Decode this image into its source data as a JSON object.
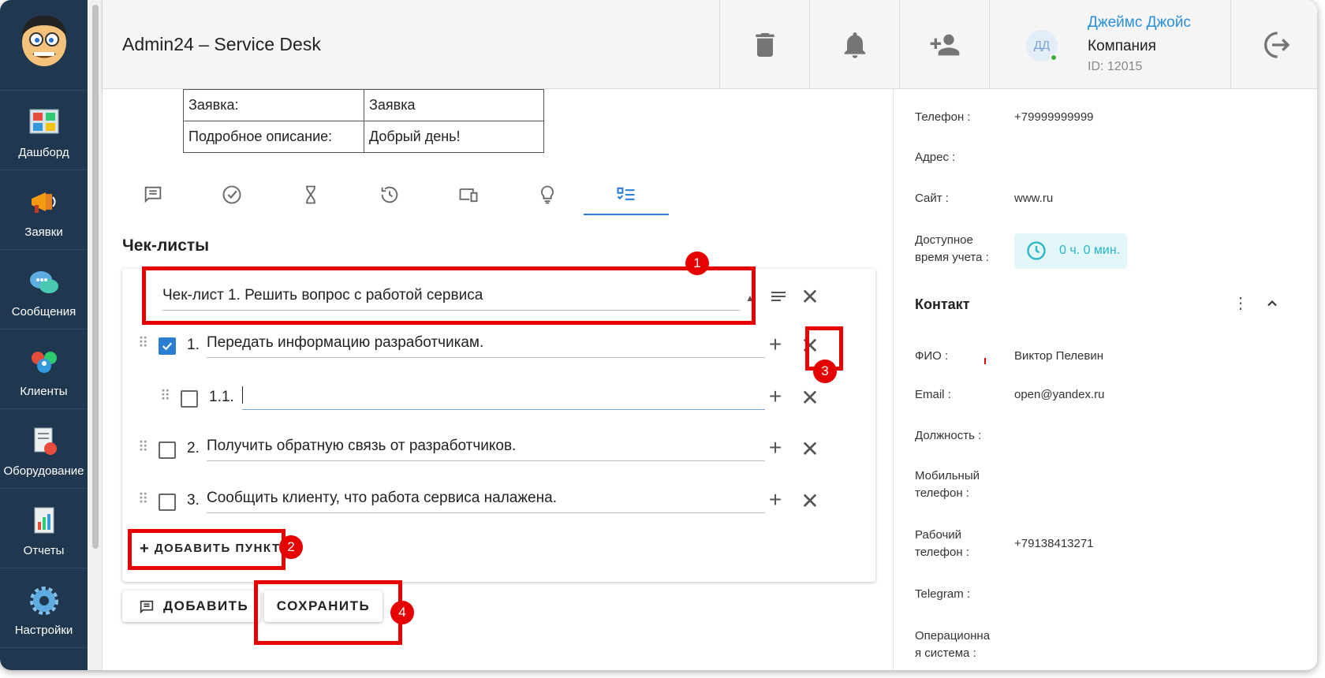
{
  "app": {
    "title": "Admin24 – Service Desk"
  },
  "sidebar": {
    "items": [
      {
        "label": "Дашборд",
        "icon": "dashboard-icon"
      },
      {
        "label": "Заявки",
        "icon": "megaphone-icon"
      },
      {
        "label": "Сообщения",
        "icon": "chat-icon"
      },
      {
        "label": "Клиенты",
        "icon": "clients-icon"
      },
      {
        "label": "Оборудование",
        "icon": "equipment-icon"
      },
      {
        "label": "Отчеты",
        "icon": "reports-icon"
      },
      {
        "label": "Настройки",
        "icon": "settings-icon"
      }
    ]
  },
  "header": {
    "user": {
      "initials": "ДД",
      "name": "Джеймс Джойс",
      "company": "Компания",
      "id": "ID: 12015"
    }
  },
  "ticket": {
    "rows": [
      {
        "key": "Заявка:",
        "value": "Заявка"
      },
      {
        "key": "Подробное описание:",
        "value": "Добрый день!"
      }
    ]
  },
  "checklists": {
    "section_title": "Чек-листы",
    "list_title": "Чек-лист 1. Решить вопрос с работой сервиса",
    "items": [
      {
        "num": "1.",
        "text": "Передать информацию разработчикам.",
        "checked": true
      },
      {
        "num": "1.1.",
        "text": "",
        "checked": false
      },
      {
        "num": "2.",
        "text": "Получить обратную связь от разработчиков.",
        "checked": false
      },
      {
        "num": "3.",
        "text": "Сообщить клиенту, что работа сервиса налажена.",
        "checked": false
      }
    ],
    "add_item_label": "ДОБАВИТЬ ПУНКТ",
    "add_label": "ДОБАВИТЬ",
    "save_label": "СОХРАНИТЬ"
  },
  "callouts": [
    "1",
    "2",
    "3",
    "4"
  ],
  "client": {
    "phone_label": "Телефон :",
    "phone": "+79999999999",
    "address_label": "Адрес :",
    "site_label": "Сайт :",
    "site": "www.ru",
    "time_label": "Доступное время учета :",
    "time_value": "0 ч. 0 мин."
  },
  "contact": {
    "title": "Контакт",
    "fio_label": "ФИО :",
    "fio": "Виктор Пелевин",
    "email_label": "Email :",
    "email": "open@yandex.ru",
    "position_label": "Должность :",
    "mobile_label": "Мобильный телефон :",
    "work_label": "Рабочий телефон :",
    "work": "+79138413271",
    "telegram_label": "Telegram :",
    "os_label": "Операционная система :"
  },
  "colors": {
    "sidebar": "#1f3850",
    "accent": "#2a7fd4",
    "callout": "#e60000",
    "link": "#2a8fd8"
  }
}
